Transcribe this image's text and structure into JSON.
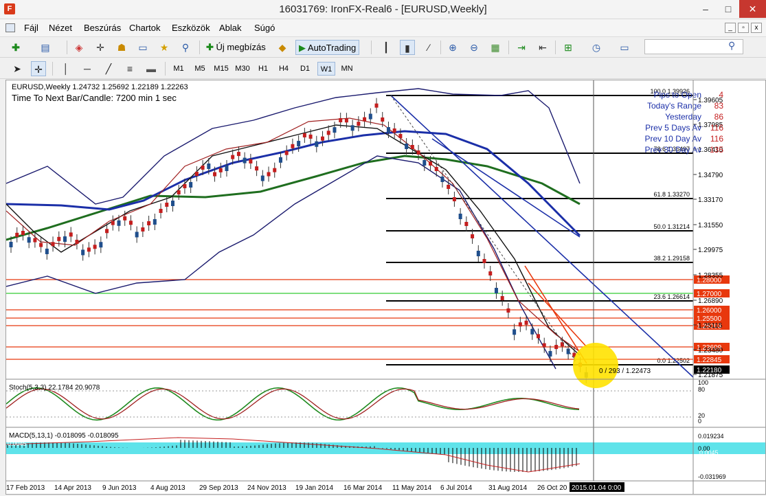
{
  "window": {
    "title": "16031769: IronFX-Real6 - [EURUSD,Weekly]",
    "app_icon": "F",
    "controls": {
      "minimize": "–",
      "maximize": "□",
      "close": "✕"
    }
  },
  "menu": {
    "items": [
      "Fájl",
      "Nézet",
      "Beszúrás",
      "Chartok",
      "Eszközök",
      "Ablak",
      "Súgó"
    ],
    "mdi": {
      "minimize": "_",
      "restore": "▫",
      "close": "x"
    }
  },
  "toolbar1": {
    "new_order": "Új megbízás",
    "autotrading": "AutoTrading"
  },
  "toolbar2": {
    "timeframes": [
      "M1",
      "M5",
      "M15",
      "M30",
      "H1",
      "H4",
      "D1",
      "W1",
      "MN"
    ],
    "active_timeframe": "W1"
  },
  "chart": {
    "header": "EURUSD,Weekly  1.24732 1.25692 1.22189 1.22263",
    "countdown": "Time To Next Bar/Candle: 7200 min 1 sec",
    "info_panel": [
      {
        "label": "Pips to Open",
        "value": "4"
      },
      {
        "label": "Today's Range",
        "value": "83"
      },
      {
        "label": "Yesterday",
        "value": "86"
      },
      {
        "label": "Prev 5 Days Av",
        "value": "116"
      },
      {
        "label": "Prev 10 Day Av",
        "value": "116"
      },
      {
        "label": "Prev 30 Day Av",
        "value": "135"
      }
    ],
    "price_scale": [
      "1.39605",
      "1.37985",
      "1.36410",
      "1.34790",
      "1.33170",
      "1.31550",
      "1.29975",
      "1.28355",
      "1.26890",
      "1.25115",
      "1.23480",
      "1.21875"
    ],
    "fib_levels": [
      {
        "label": "100.0 1.39926"
      },
      {
        "label": "78.6 1.36497"
      },
      {
        "label": "61.8 1.33270"
      },
      {
        "label": "50.0 1.31214"
      },
      {
        "label": "38.2 1.29158"
      },
      {
        "label": "23.6 1.26614"
      },
      {
        "label": "0.0 1.22502"
      }
    ],
    "price_tags": [
      {
        "text": "1.28000",
        "color": "#e8380d"
      },
      {
        "text": "1.27000",
        "color": "#e8380d"
      },
      {
        "text": "1.26000",
        "color": "#e8380d"
      },
      {
        "text": "1.25500",
        "color": "#e8380d"
      },
      {
        "text": "1.25003",
        "color": "#e8380d"
      },
      {
        "text": "1.23609",
        "color": "#e8380d"
      },
      {
        "text": "1.22845",
        "color": "#e8380d"
      },
      {
        "text": "1.22180",
        "color": "#000000"
      }
    ],
    "crosshair_label": "0 / 293 / 1.22473",
    "stoch": {
      "header": "Stoch(5,3,3) 22.1784 20.9078",
      "scale": [
        "100",
        "80",
        "20",
        "0"
      ]
    },
    "macd": {
      "header": "MACD(5,13,1) -0.018095 -0.018095",
      "scale": [
        "0.019234",
        "0.00",
        "-0.031969"
      ],
      "hl_tags": [
        "0.0045",
        "0.0045"
      ]
    },
    "date_axis": [
      "17 Feb 2013",
      "14 Apr 2013",
      "9 Jun 2013",
      "4 Aug 2013",
      "29 Sep 2013",
      "24 Nov 2013",
      "19 Jan 2014",
      "16 Mar 2014",
      "11 May 2014",
      "6 Jul 2014",
      "31 Aug 2014",
      "26 Oct 20",
      "2015.01.04 0:00"
    ],
    "colors": {
      "bull": "#1f4e8c",
      "bear": "#c41e1e",
      "bollinger": "#1a1a6e",
      "ma_blue": "#1b2fa8",
      "ma_green": "#1f6e1f",
      "highlight": "#ffe200",
      "macd_band": "#5fe3ea"
    }
  }
}
